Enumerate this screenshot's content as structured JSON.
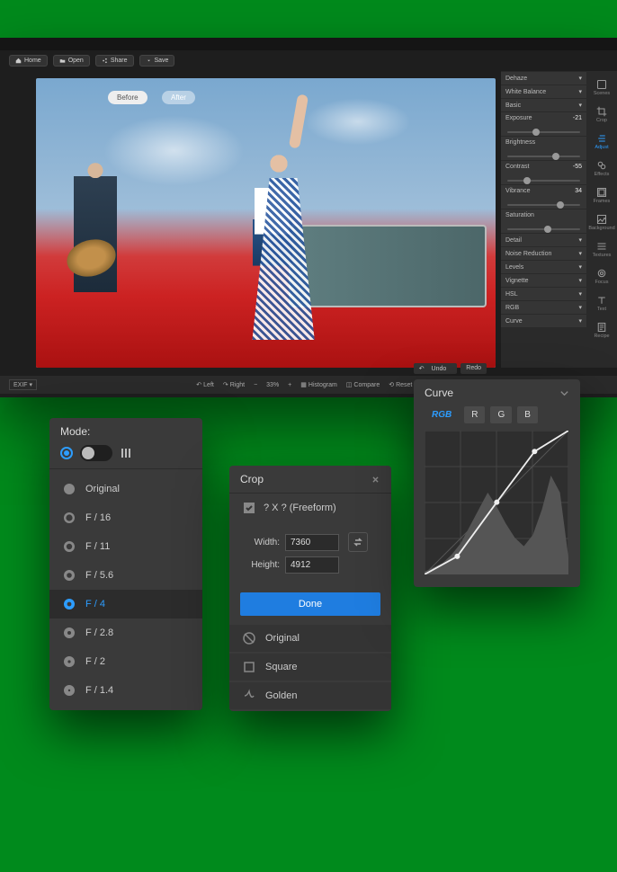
{
  "menubar": {
    "home": "Home",
    "open": "Open",
    "share": "Share",
    "save": "Save"
  },
  "compare": {
    "before": "Before",
    "after": "After"
  },
  "sliders": {
    "dehaze": "Dehaze",
    "wb": "White Balance",
    "basic": "Basic",
    "exposure": {
      "label": "Exposure",
      "value": "-21",
      "pos": 35
    },
    "brightness": {
      "label": "Brightness",
      "value": "",
      "pos": 62
    },
    "contrast": {
      "label": "Contrast",
      "value": "-55",
      "pos": 22
    },
    "vibrance": {
      "label": "Vibrance",
      "value": "34",
      "pos": 68
    },
    "saturation": {
      "label": "Saturation",
      "value": "",
      "pos": 50
    },
    "detail": "Detail",
    "noise": "Noise Reduction",
    "levels": "Levels",
    "vignette": "Vignette",
    "hsl": "HSL",
    "rgb": "RGB",
    "curve": "Curve"
  },
  "undo": {
    "undo": "Undo",
    "redo": "Redo"
  },
  "status": {
    "left": "Left",
    "right": "Right",
    "zoom": "33%",
    "histogram": "Histogram",
    "compare": "Compare",
    "reset": "Reset All",
    "exif": "EXIF"
  },
  "rail": {
    "scenes": "Scenes",
    "crop": "Crop",
    "adjust": "Adjust",
    "effects": "Effects",
    "frames": "Frames",
    "background": "Background",
    "textures": "Textures",
    "focus": "Focus",
    "text": "Text",
    "recipe": "Recipe"
  },
  "aperture": {
    "mode": "Mode:",
    "items": [
      "Original",
      "F / 16",
      "F / 11",
      "F / 5.6",
      "F / 4",
      "F / 2.8",
      "F / 2",
      "F / 1.4"
    ],
    "selected": 4
  },
  "crop": {
    "title": "Crop",
    "freeform": "? X ? (Freeform)",
    "width_label": "Width:",
    "width": "7360",
    "height_label": "Height:",
    "height": "4912",
    "done": "Done",
    "presets": [
      "Original",
      "Square",
      "Golden"
    ]
  },
  "curve": {
    "title": "Curve",
    "channels": [
      "RGB",
      "R",
      "G",
      "B"
    ]
  },
  "chart_data": {
    "type": "line",
    "title": "Curve",
    "xlabel": "",
    "ylabel": "",
    "xlim": [
      0,
      255
    ],
    "ylim": [
      0,
      255
    ],
    "series": [
      {
        "name": "RGB",
        "x": [
          0,
          58,
          128,
          195,
          255
        ],
        "y": [
          0,
          32,
          128,
          218,
          255
        ]
      }
    ],
    "histogram": {
      "x": [
        0,
        16,
        32,
        48,
        64,
        80,
        96,
        112,
        128,
        144,
        160,
        176,
        192,
        208,
        224,
        240,
        255
      ],
      "y": [
        2,
        5,
        8,
        14,
        22,
        34,
        46,
        58,
        48,
        36,
        26,
        20,
        28,
        46,
        70,
        58,
        12
      ]
    }
  }
}
